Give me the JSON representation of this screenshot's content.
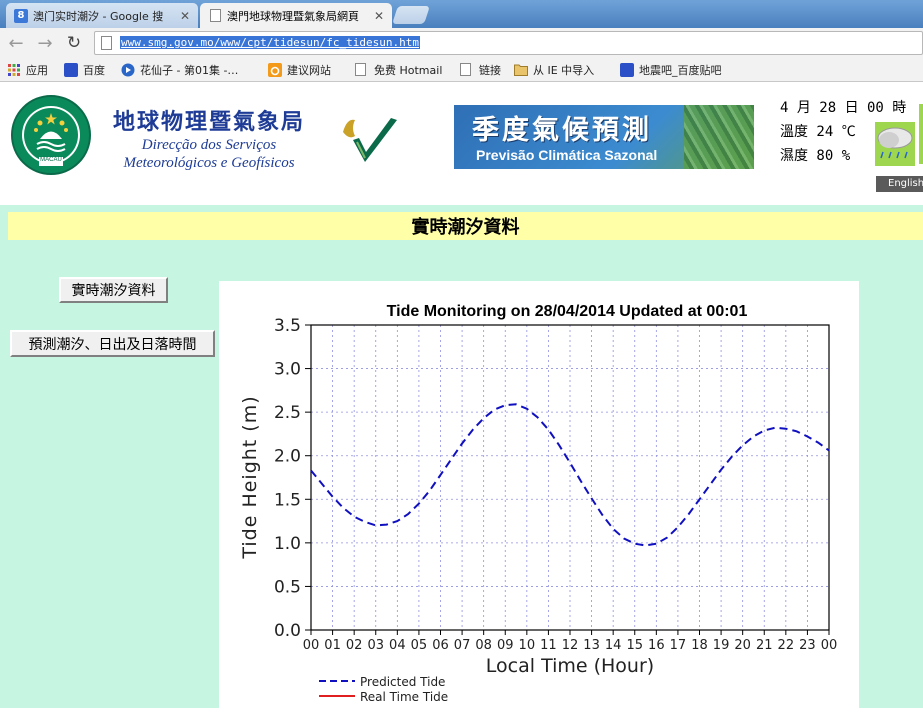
{
  "browser": {
    "tabs": [
      {
        "title": "澳门实时潮汐 - Google 搜",
        "icon": "google-favicon-icon",
        "active": false
      },
      {
        "title": "澳門地球物理暨氣象局網頁",
        "icon": "page-favicon-icon",
        "active": true
      }
    ],
    "url": "www.smg.gov.mo/www/cpt/tidesun/fc_tidesun.htm",
    "bookmarks": [
      {
        "label": "应用",
        "icon": "apps-grid-icon"
      },
      {
        "label": "百度",
        "icon": "baidu-paw-icon"
      },
      {
        "label": "花仙子 - 第01集 -…",
        "icon": "video-play-icon"
      },
      {
        "label": "建议网站",
        "icon": "suggest-sites-icon"
      },
      {
        "label": "免费 Hotmail",
        "icon": "page-icon"
      },
      {
        "label": "链接",
        "icon": "page-icon"
      },
      {
        "label": "从 IE 中导入",
        "icon": "folder-icon"
      },
      {
        "label": "地震吧_百度贴吧",
        "icon": "baidu-paw-icon"
      }
    ]
  },
  "header": {
    "org_name_cn": "地球物理暨氣象局",
    "org_name_pt_1": "Direcção dos Serviços",
    "org_name_pt_2": "Meteorológicos e Geofísicos",
    "emblem_text": "MACAU",
    "banner_cn": "季度氣候預測",
    "banner_pt": "Previsão Climática Sazonal",
    "date_line": "4 月 28 日 00 時",
    "temp_line": "溫度 24 ℃",
    "humidity_line": "濕度 80 %",
    "english_label": "English"
  },
  "page": {
    "title": "實時潮汐資料",
    "buttons": [
      {
        "label": "實時潮汐資料"
      },
      {
        "label": "預測潮汐、日出及日落時間"
      }
    ]
  },
  "chart_data": {
    "type": "line",
    "title": "Tide Monitoring on 28/04/2014   Updated at  00:01",
    "xlabel": "Local Time (Hour)",
    "ylabel": "Tide Height (m)",
    "xlim": [
      0,
      24
    ],
    "ylim": [
      0.0,
      3.5
    ],
    "x_ticks": [
      "00",
      "01",
      "02",
      "03",
      "04",
      "05",
      "06",
      "07",
      "08",
      "09",
      "10",
      "11",
      "12",
      "13",
      "14",
      "15",
      "16",
      "17",
      "18",
      "19",
      "20",
      "21",
      "22",
      "23",
      "00"
    ],
    "y_ticks": [
      "0.0",
      "0.5",
      "1.0",
      "1.5",
      "2.0",
      "2.5",
      "3.0",
      "3.5"
    ],
    "grid": true,
    "series": [
      {
        "name": "Predicted Tide",
        "color": "#1010c0",
        "style": "dashed",
        "x": [
          0,
          0.5,
          1,
          1.5,
          2,
          2.5,
          3,
          3.5,
          4,
          4.5,
          5,
          5.5,
          6,
          6.5,
          7,
          7.5,
          8,
          8.5,
          9,
          9.5,
          10,
          10.5,
          11,
          11.5,
          12,
          12.5,
          13,
          13.5,
          14,
          14.5,
          15,
          15.5,
          16,
          16.5,
          17,
          17.5,
          18,
          18.5,
          19,
          19.5,
          20,
          20.5,
          21,
          21.5,
          22,
          22.5,
          23,
          23.5,
          24
        ],
        "y": [
          1.83,
          1.68,
          1.53,
          1.4,
          1.3,
          1.24,
          1.2,
          1.21,
          1.25,
          1.33,
          1.45,
          1.6,
          1.78,
          1.96,
          2.14,
          2.3,
          2.43,
          2.53,
          2.58,
          2.59,
          2.54,
          2.44,
          2.3,
          2.12,
          1.92,
          1.71,
          1.51,
          1.32,
          1.16,
          1.05,
          0.99,
          0.97,
          0.99,
          1.06,
          1.18,
          1.33,
          1.5,
          1.67,
          1.84,
          1.99,
          2.12,
          2.22,
          2.29,
          2.32,
          2.31,
          2.28,
          2.22,
          2.15,
          2.06
        ]
      },
      {
        "name": "Real Time Tide",
        "color": "#e02020",
        "style": "solid",
        "x": [],
        "y": []
      }
    ]
  }
}
